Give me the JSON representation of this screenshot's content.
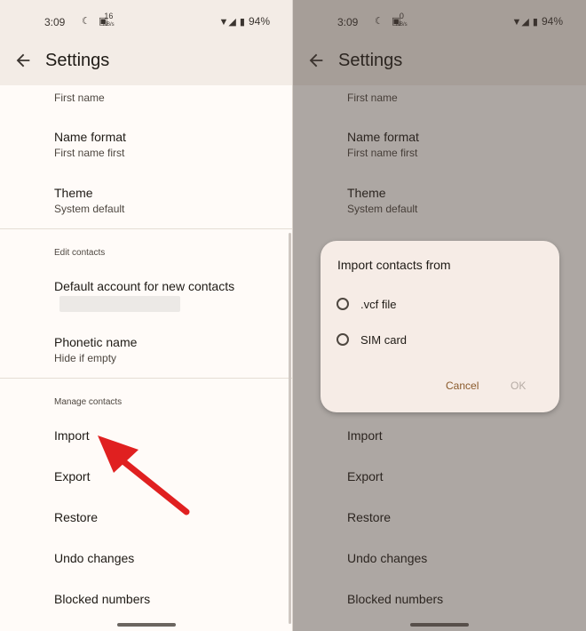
{
  "left": {
    "status": {
      "time": "3:09",
      "moon": "☾",
      "kbs_value": "16",
      "kbs_unit": "KB/s",
      "battery": "94%"
    },
    "appbar": {
      "title": "Settings"
    },
    "partial_item_subtitle": "First name",
    "items_top": [
      {
        "title": "Name format",
        "subtitle": "First name first"
      },
      {
        "title": "Theme",
        "subtitle": "System default"
      }
    ],
    "section_edit": "Edit contacts",
    "default_account_title": "Default account for new contacts",
    "phonetic": {
      "title": "Phonetic name",
      "subtitle": "Hide if empty"
    },
    "section_manage": "Manage contacts",
    "manage_items": [
      "Import",
      "Export",
      "Restore",
      "Undo changes",
      "Blocked numbers"
    ]
  },
  "right": {
    "status": {
      "time": "3:09",
      "moon": "☾",
      "kbs_value": "0",
      "kbs_unit": "KB/s",
      "battery": "94%"
    },
    "appbar": {
      "title": "Settings"
    },
    "partial_item_subtitle": "First name",
    "items_top": [
      {
        "title": "Name format",
        "subtitle": "First name first"
      },
      {
        "title": "Theme",
        "subtitle": "System default"
      }
    ],
    "manage_items": [
      "Import",
      "Export",
      "Restore",
      "Undo changes",
      "Blocked numbers"
    ],
    "dialog": {
      "title": "Import contacts from",
      "options": [
        ".vcf file",
        "SIM card"
      ],
      "cancel": "Cancel",
      "ok": "OK"
    }
  },
  "colors": {
    "annotation_arrow": "#e02020",
    "accent": "#8a5a2b"
  }
}
